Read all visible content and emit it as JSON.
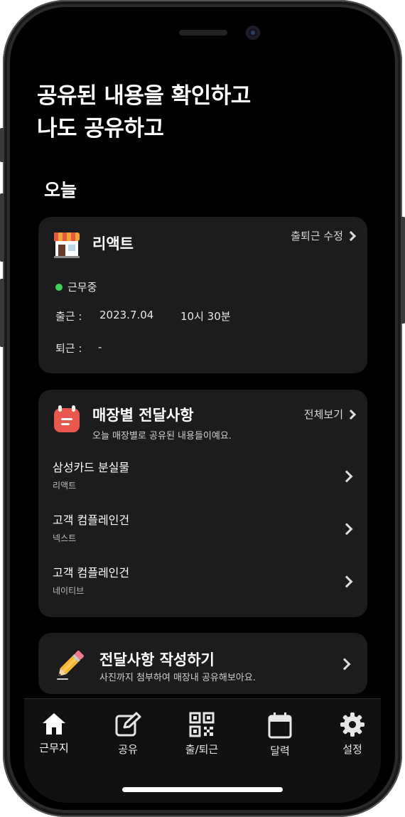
{
  "headline": {
    "line1": "공유된 내용을 확인하고",
    "line2": "나도 공유하고"
  },
  "today": {
    "section_title": "오늘",
    "store_card": {
      "icon": "store-icon",
      "store_name": "리액트",
      "edit_link": "출퇴근 수정",
      "status": "근무중",
      "status_color": "#3dd15a",
      "clock_in_label": "출근 :",
      "clock_in_date": "2023.7.04",
      "clock_in_time": "10시 30분",
      "clock_out_label": "퇴근 :",
      "clock_out_value": "-"
    }
  },
  "notices": {
    "icon": "memo-icon",
    "title": "매장별 전달사항",
    "subtitle": "오늘 매장별로 공유된 내용들이예요.",
    "view_all": "전체보기",
    "items": [
      {
        "title": "삼성카드 분실물",
        "store": "리액트"
      },
      {
        "title": "고객 컴플레인건",
        "store": "넥스트"
      },
      {
        "title": "고객 컴플레인건",
        "store": "네이티브"
      }
    ]
  },
  "write": {
    "icon": "pencil-icon",
    "title": "전달사항 작성하기",
    "subtitle": "사진까지 첨부하여 매장내 공유해보아요."
  },
  "tabbar": {
    "tabs": [
      {
        "label": "근무지",
        "icon": "home-icon",
        "active": true
      },
      {
        "label": "공유",
        "icon": "edit-icon",
        "active": false
      },
      {
        "label": "출/퇴근",
        "icon": "qr-icon",
        "active": false
      },
      {
        "label": "달력",
        "icon": "calendar-icon",
        "active": false
      },
      {
        "label": "설정",
        "icon": "gear-icon",
        "active": false
      }
    ]
  },
  "colors": {
    "background": "#000000",
    "card": "#1c1c1e",
    "accent_green": "#3dd15a",
    "memo_red": "#e8584f"
  }
}
